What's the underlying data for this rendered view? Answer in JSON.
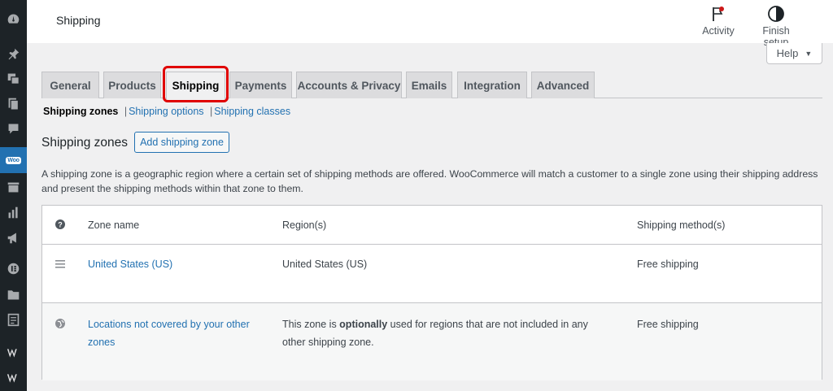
{
  "header": {
    "title": "Shipping",
    "activity_label": "Activity",
    "finish_setup_label": "Finish setup"
  },
  "help": {
    "label": "Help",
    "caret": "▼"
  },
  "tabs": [
    {
      "label": "General"
    },
    {
      "label": "Products"
    },
    {
      "label": "Shipping",
      "active": true
    },
    {
      "label": "Payments"
    },
    {
      "label": "Accounts & Privacy"
    },
    {
      "label": "Emails"
    },
    {
      "label": "Integration"
    },
    {
      "label": "Advanced"
    }
  ],
  "subnav": {
    "current": "Shipping zones",
    "options": "Shipping options",
    "classes": "Shipping classes",
    "separator": "|"
  },
  "zones": {
    "heading": "Shipping zones",
    "add_button": "Add shipping zone",
    "description": "A shipping zone is a geographic region where a certain set of shipping methods are offered. WooCommerce will match a customer to a single zone using their shipping address and present the shipping methods within that zone to them.",
    "columns": {
      "name": "Zone name",
      "regions": "Region(s)",
      "methods": "Shipping method(s)"
    },
    "rows": [
      {
        "name": "United States (US)",
        "regions": "United States (US)",
        "methods": "Free shipping"
      },
      {
        "name_line1": "Locations not covered by your other",
        "name_line2": "zones",
        "regions_pre": "This zone is ",
        "regions_bold": "optionally",
        "regions_post": " used for regions that are not included in any",
        "regions_line2": "other shipping zone.",
        "methods": "Free shipping"
      }
    ]
  },
  "sidebar": {
    "icons": [
      "dashboard-icon",
      "pin-icon",
      "media-icon",
      "pages-icon",
      "comments-icon",
      "woocommerce-icon",
      "products-icon",
      "analytics-icon",
      "marketing-icon",
      "elementor-icon",
      "folder-icon",
      "form-icon",
      "w-logo-icon",
      "w-logo-icon-2"
    ],
    "woo_badge": "Woo"
  },
  "colors": {
    "accent": "#2271b1",
    "highlight": "#e00000",
    "sidebar_bg": "#1d2327"
  }
}
